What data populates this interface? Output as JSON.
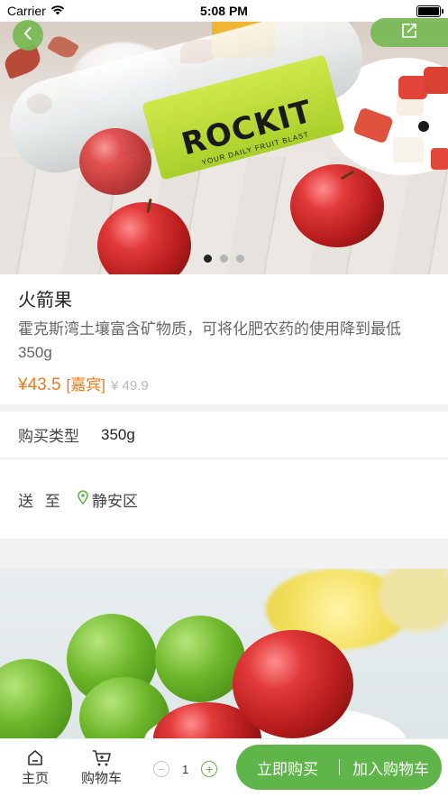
{
  "status_bar": {
    "carrier": "Carrier",
    "time": "5:08 PM"
  },
  "hero": {
    "brand_text": "ROCKIT",
    "brand_sub": "YOUR DAILY FRUIT BLAST",
    "carousel_count": 3,
    "carousel_active": 1
  },
  "product": {
    "name": "火箭果",
    "description": "霍克斯湾土壤富含矿物质，可将化肥农药的使用降到最低350g",
    "price": "¥43.5",
    "vip_tag": "[嘉宾]",
    "original_price": "¥ 49.9"
  },
  "spec": {
    "label": "购买类型",
    "value": "350g"
  },
  "delivery": {
    "label": "送 至",
    "location": "静安区"
  },
  "bottom_bar": {
    "home_label": "主页",
    "cart_label": "购物车",
    "quantity": "1",
    "buy_now_label": "立即购买",
    "add_to_cart_label": "加入购物车"
  },
  "colors": {
    "accent_green": "#5fb54a",
    "price_orange": "#f07a1a",
    "muted_gray": "#b8b8b8"
  },
  "icons": {
    "back": "chevron-left-icon",
    "share": "share-icon",
    "location": "location-pin-icon",
    "home": "home-icon",
    "cart": "cart-icon",
    "minus": "minus-circle-icon",
    "plus": "plus-circle-icon",
    "wifi": "wifi-icon",
    "battery": "battery-icon"
  }
}
